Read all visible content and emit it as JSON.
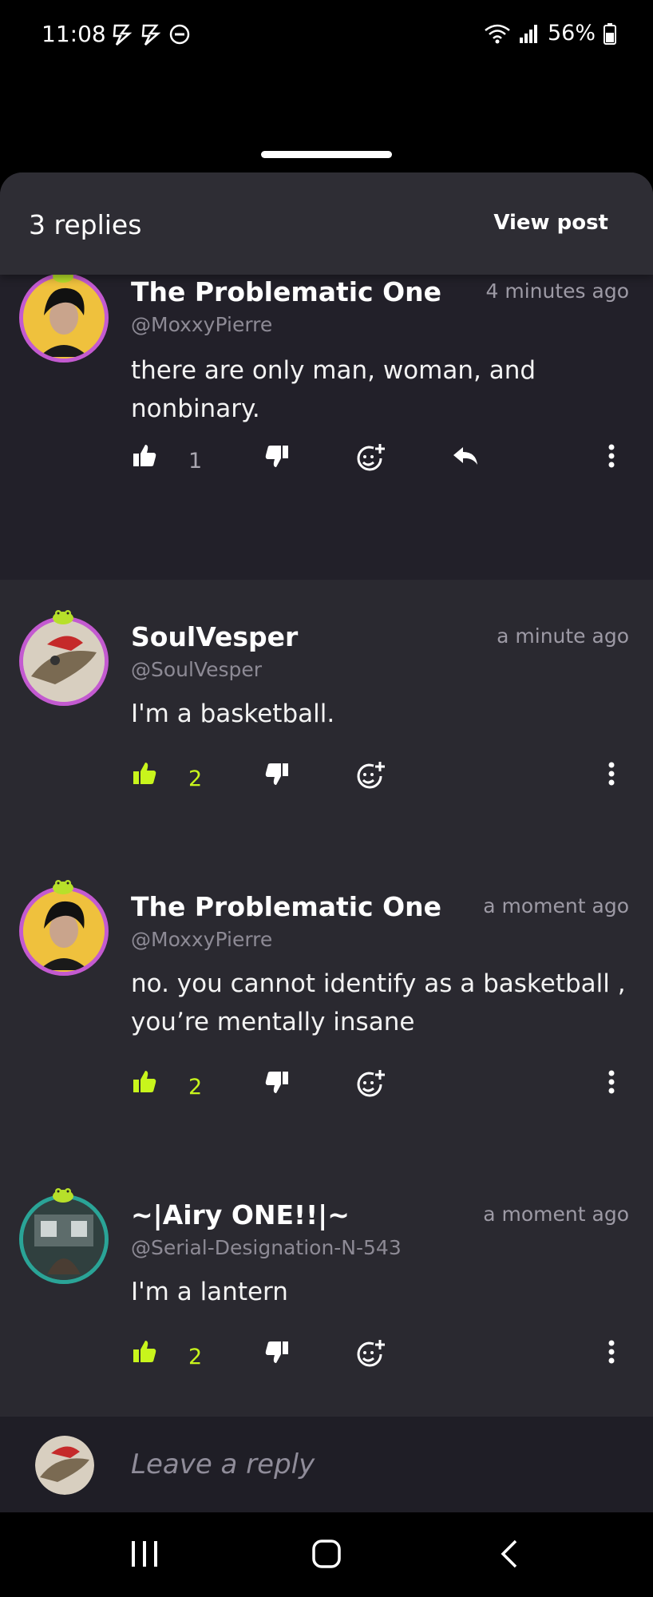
{
  "status_bar": {
    "time": "11:08",
    "battery": "56%"
  },
  "sheet": {
    "replies_count": "3 replies",
    "view_post": "View post"
  },
  "comments": [
    {
      "author": "The Problematic One",
      "handle": "@MoxxyPierre",
      "time": "4 minutes ago",
      "text": "there are only man, woman, and nonbinary.",
      "likes": "1",
      "liked": false,
      "has_reply_button": true
    },
    {
      "author": "SoulVesper",
      "handle": "@SoulVesper",
      "time": "a minute ago",
      "text": "I'm a basketball.",
      "likes": "2",
      "liked": true,
      "has_reply_button": false
    },
    {
      "author": "The Problematic One",
      "handle": "@MoxxyPierre",
      "time": "a moment ago",
      "text": "no. you cannot identify as a basketball , you’re mentally insane",
      "likes": "2",
      "liked": true,
      "has_reply_button": false
    },
    {
      "author": "~|Airy ONE!!|~",
      "handle": "@Serial-Designation-N-543",
      "time": "a moment ago",
      "text": "I'm a lantern",
      "likes": "2",
      "liked": true,
      "has_reply_button": false
    }
  ],
  "reply_input": {
    "placeholder": "Leave a reply"
  },
  "icons": {
    "like": "thumbs-up-icon",
    "dislike": "thumbs-down-icon",
    "react": "emoji-add-icon",
    "reply": "reply-arrow-icon",
    "more": "more-vertical-icon"
  },
  "colors": {
    "accent_like": "#c8f51c",
    "avatar_ring_pink": "#c35ad0",
    "avatar_ring_teal": "#2aa497"
  }
}
